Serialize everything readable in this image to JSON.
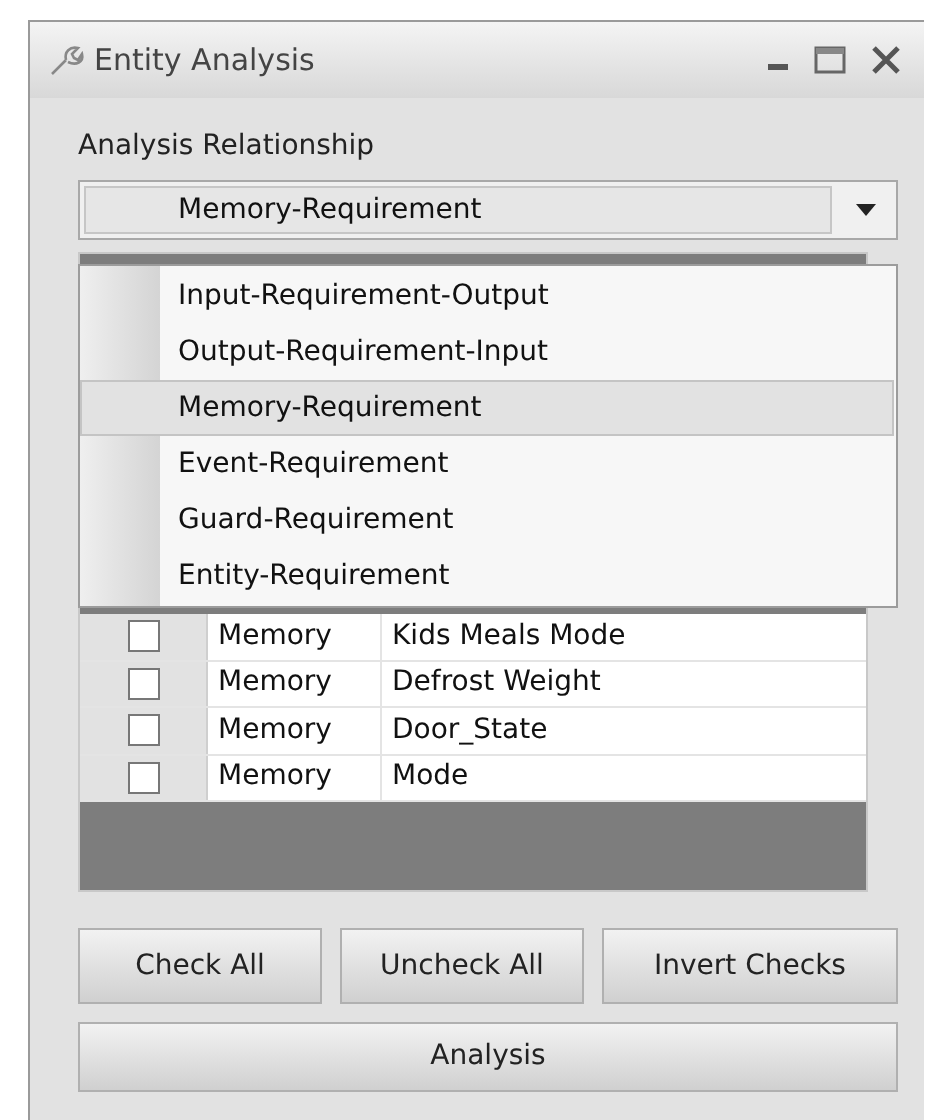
{
  "window": {
    "title": "Entity Analysis"
  },
  "relationship": {
    "label": "Analysis Relationship",
    "value": "Memory-Requirement"
  },
  "dropdown": {
    "options": [
      {
        "label": "Input-Requirement-Output",
        "selected": false
      },
      {
        "label": "Output-Requirement-Input",
        "selected": false
      },
      {
        "label": "Memory-Requirement",
        "selected": true
      },
      {
        "label": "Event-Requirement",
        "selected": false
      },
      {
        "label": "Guard-Requirement",
        "selected": false
      },
      {
        "label": "Entity-Requirement",
        "selected": false
      }
    ]
  },
  "table": {
    "rows": [
      {
        "checked": false,
        "type": "Memory",
        "name": "Kids Meals Mode"
      },
      {
        "checked": false,
        "type": "Memory",
        "name": "Defrost Weight"
      },
      {
        "checked": false,
        "type": "Memory",
        "name": "Door_State"
      },
      {
        "checked": false,
        "type": "Memory",
        "name": "Mode"
      }
    ]
  },
  "buttons": [
    "Check All",
    "Uncheck All",
    "Invert Checks"
  ],
  "analysis_button": "Analysis"
}
